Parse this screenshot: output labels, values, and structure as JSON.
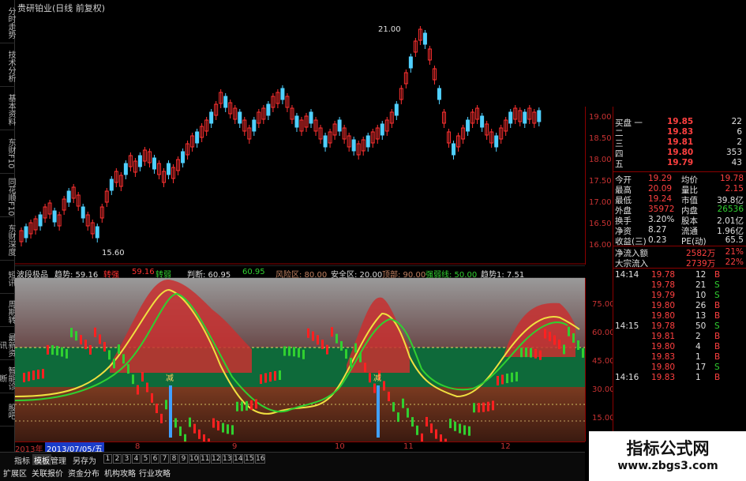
{
  "title": "贵研铂业(日线 前复权)",
  "left_tabs": [
    "分时走势",
    "技术分析",
    "基本资料",
    "东财F10",
    "同花顺F10",
    "东财深度",
    "短讯",
    "周期转",
    "最新资讯",
    "智能诊断",
    "股吧"
  ],
  "kline": {
    "high_label": "21.00",
    "low_label": "15.60",
    "price_axis": [
      "19.00",
      "18.50",
      "18.00",
      "17.50",
      "17.00",
      "16.50",
      "16.00"
    ]
  },
  "indicator_bar": [
    {
      "text": "波段极品",
      "color": "#dcdcdc"
    },
    {
      "text": "趋势: 59.16",
      "color": "#dcdcdc"
    },
    {
      "text": "转强",
      "color": "#ff3030"
    },
    {
      "text": "59.16",
      "color": "#ff3030"
    },
    {
      "text": "转弱",
      "color": "#30d030"
    },
    {
      "text": "判断: 60.95",
      "color": "#dcdcdc"
    },
    {
      "text": "60.95",
      "color": "#30d030"
    },
    {
      "text": "风险区: 80.00",
      "color": "#c08060"
    },
    {
      "text": "安全区: 20.00",
      "color": "#dcdcdc"
    },
    {
      "text": "顶部: 90.00",
      "color": "#c08060"
    },
    {
      "text": "强弱线: 50.00",
      "color": "#30d030"
    },
    {
      "text": "趋势1: 7.51",
      "color": "#dcdcdc"
    }
  ],
  "indicator": {
    "axis": [
      "75.00",
      "60.00",
      "45.00",
      "30.00",
      "15.00"
    ],
    "signal_label": "减"
  },
  "date_bar": {
    "year": "2013年",
    "date": "2013/07/05/五",
    "months": [
      "8",
      "9",
      "10",
      "11",
      "12"
    ]
  },
  "quote": {
    "asks": [
      {
        "label": "买盘 一",
        "price": "19.85",
        "vol": "22"
      },
      {
        "label": "二",
        "price": "19.83",
        "vol": "6"
      },
      {
        "label": "三",
        "price": "19.81",
        "vol": "2"
      },
      {
        "label": "四",
        "price": "19.80",
        "vol": "353"
      },
      {
        "label": "五",
        "price": "19.79",
        "vol": "43"
      }
    ],
    "stats": [
      {
        "k1": "今开",
        "v1": "19.29",
        "c1": "#ff4040",
        "k2": "均价",
        "v2": "19.78",
        "c2": "#ff4040"
      },
      {
        "k1": "最高",
        "v1": "20.09",
        "c1": "#ff4040",
        "k2": "量比",
        "v2": "2.15",
        "c2": "#ff4040"
      },
      {
        "k1": "最低",
        "v1": "19.24",
        "c1": "#ff4040",
        "k2": "市值",
        "v2": "39.8亿",
        "c2": "#e0e0e0"
      },
      {
        "k1": "外盘",
        "v1": "35972",
        "c1": "#ff4040",
        "k2": "内盘",
        "v2": "26536",
        "c2": "#30d030"
      },
      {
        "k1": "换手",
        "v1": "3.20%",
        "c1": "#e0e0e0",
        "k2": "股本",
        "v2": "2.01亿",
        "c2": "#e0e0e0"
      },
      {
        "k1": "净资",
        "v1": "8.27",
        "c1": "#e0e0e0",
        "k2": "流通",
        "v2": "1.96亿",
        "c2": "#e0e0e0"
      },
      {
        "k1": "收益(三)",
        "v1": "0.23",
        "c1": "#e0e0e0",
        "k2": "PE(动)",
        "v2": "65.5",
        "c2": "#e0e0e0"
      }
    ],
    "flows": [
      {
        "label": "净流入额",
        "value": "2582万",
        "pct": "21%"
      },
      {
        "label": "大宗流入",
        "value": "2739万",
        "pct": "22%"
      }
    ],
    "ticks": [
      {
        "time": "14:14",
        "price": "19.78",
        "vol": "12",
        "side": "B"
      },
      {
        "time": "",
        "price": "19.78",
        "vol": "21",
        "side": "S"
      },
      {
        "time": "",
        "price": "19.79",
        "vol": "10",
        "side": "S"
      },
      {
        "time": "",
        "price": "19.80",
        "vol": "26",
        "side": "B"
      },
      {
        "time": "",
        "price": "19.80",
        "vol": "13",
        "side": "B"
      },
      {
        "time": "14:15",
        "price": "19.78",
        "vol": "50",
        "side": "S"
      },
      {
        "time": "",
        "price": "19.81",
        "vol": "2",
        "side": "B"
      },
      {
        "time": "",
        "price": "19.80",
        "vol": "4",
        "side": "B"
      },
      {
        "time": "",
        "price": "19.83",
        "vol": "1",
        "side": "B"
      },
      {
        "time": "",
        "price": "19.80",
        "vol": "17",
        "side": "S"
      },
      {
        "time": "14:16",
        "price": "19.83",
        "vol": "1",
        "side": "B"
      }
    ]
  },
  "tabs_row1": [
    "指标",
    "模板",
    "管理",
    "另存为"
  ],
  "tabs_row1_nums": [
    "1",
    "2",
    "3",
    "4",
    "5",
    "6",
    "7",
    "8",
    "9",
    "10",
    "11",
    "12",
    "13",
    "14",
    "15",
    "16"
  ],
  "tabs_row2": [
    "扩展区",
    "关联报价",
    "资金分布",
    "机构攻略",
    "行业攻略"
  ],
  "watermark": {
    "line1": "指标公式网",
    "line2": "www.zbgs3.com"
  }
}
